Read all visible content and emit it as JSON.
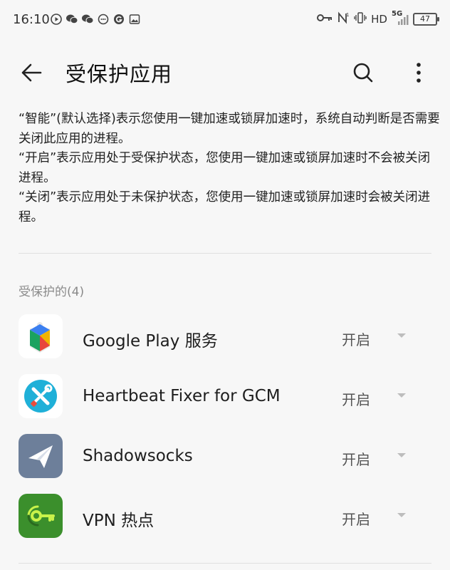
{
  "status_bar": {
    "time": "16:10",
    "left_icons": [
      "media-play-icon",
      "wechat-icon",
      "wechat-icon",
      "chat-bubble-icon",
      "g-icon",
      "image-icon"
    ],
    "network": "HD",
    "signal": "5G",
    "battery": "47"
  },
  "header": {
    "title": "受保护应用"
  },
  "description": [
    "“智能”(默认选择)表示您使用一键加速或锁屏加速时，系统自动判断是否需要关闭此应用的进程。",
    "“开启”表示应用处于受保护状态，您使用一键加速或锁屏加速时不会被关闭进程。",
    "“关闭”表示应用处于未保护状态，您使用一键加速或锁屏加速时会被关闭进程。"
  ],
  "section": {
    "label": "受保护的(4)"
  },
  "apps": [
    {
      "name": "Google Play 服务",
      "status": "开启",
      "icon": "google-play-services-icon"
    },
    {
      "name": "Heartbeat Fixer for GCM",
      "status": "开启",
      "icon": "heartbeat-fixer-icon"
    },
    {
      "name": "Shadowsocks",
      "status": "开启",
      "icon": "shadowsocks-icon"
    },
    {
      "name": "VPN 热点",
      "status": "开启",
      "icon": "vpn-hotspot-icon"
    }
  ],
  "colors": {
    "background": "#f7f7f7",
    "heartbeat_bg": "#1fb0d8",
    "shadowsocks_bg": "#6d7f9a",
    "vpn_bg": "#3b8f2c",
    "vpn_accent": "#c8f24a"
  }
}
